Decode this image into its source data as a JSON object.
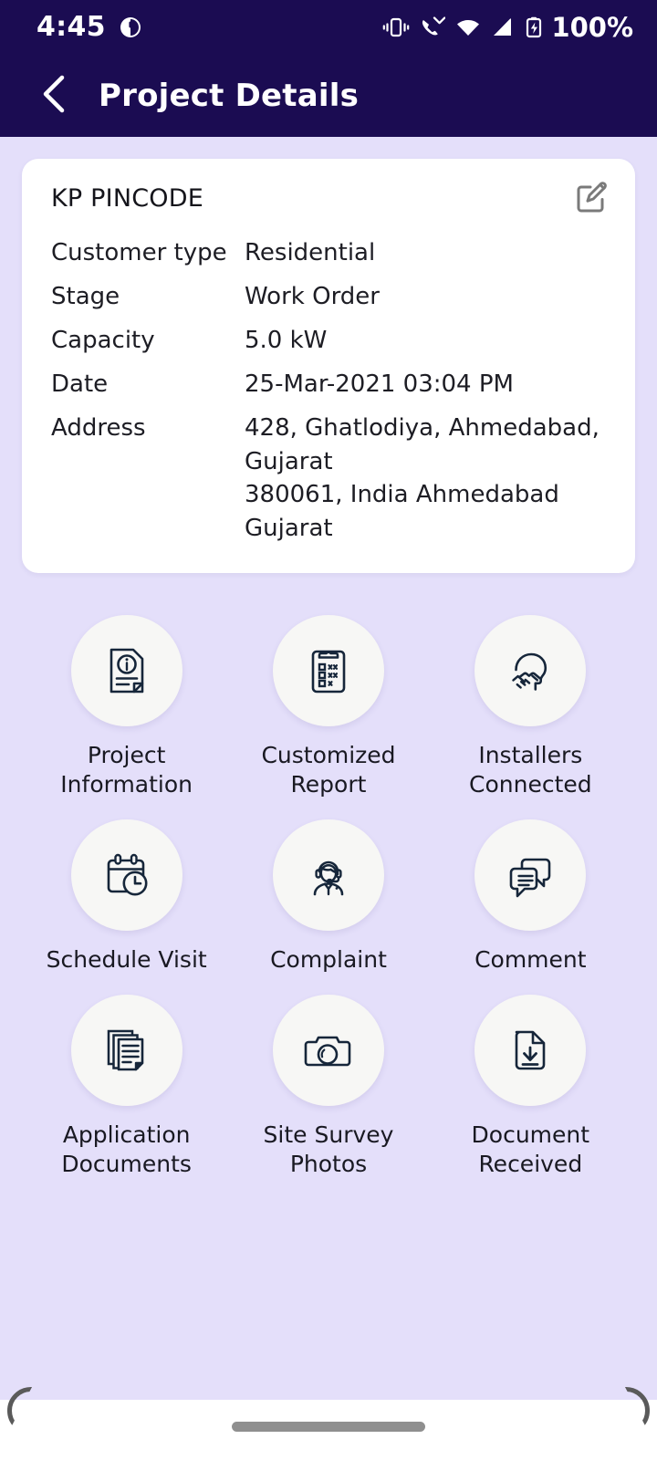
{
  "status_bar": {
    "time": "4:45",
    "battery_percent": "100%",
    "icons": [
      "app-badge-icon",
      "vibrate-icon",
      "missed-call-icon",
      "wifi-icon",
      "signal-icon",
      "battery-charging-icon"
    ]
  },
  "app_bar": {
    "back_icon": "chevron-left-icon",
    "title": "Project Details"
  },
  "card": {
    "title": "KP PINCODE",
    "edit_icon": "edit-pencil-square-icon",
    "fields": [
      {
        "label": "Customer type",
        "value": "Residential"
      },
      {
        "label": "Stage",
        "value": "Work Order"
      },
      {
        "label": "Capacity",
        "value": "5.0 kW"
      },
      {
        "label": "Date",
        "value": "25-Mar-2021 03:04 PM"
      },
      {
        "label": "Address",
        "value": "428, Ghatlodiya, Ahmedabad, Gujarat\n380061, India Ahmedabad Gujarat"
      }
    ]
  },
  "grid": {
    "tiles": [
      {
        "label": "Project\nInformation",
        "icon": "document-info-icon"
      },
      {
        "label": "Customized\nReport",
        "icon": "clipboard-checklist-icon"
      },
      {
        "label": "Installers\nConnected",
        "icon": "handshake-head-icon"
      },
      {
        "label": "Schedule Visit",
        "icon": "calendar-clock-icon"
      },
      {
        "label": "Complaint",
        "icon": "support-agent-headset-icon"
      },
      {
        "label": "Comment",
        "icon": "chat-bubbles-icon"
      },
      {
        "label": "Application\nDocuments",
        "icon": "stacked-documents-icon"
      },
      {
        "label": "Site Survey\nPhotos",
        "icon": "camera-icon"
      },
      {
        "label": "Document\nReceived",
        "icon": "document-download-icon"
      }
    ]
  },
  "gesture_bar": {
    "home_indicator": "home-indicator-pill"
  },
  "colors": {
    "header": "#1B0C52",
    "page_background": "#E4DFFA",
    "card_background": "#FFFFFF",
    "tile_circle": "#F7F7F5",
    "icon_stroke": "#16263A",
    "text_primary": "#1D1D24"
  }
}
